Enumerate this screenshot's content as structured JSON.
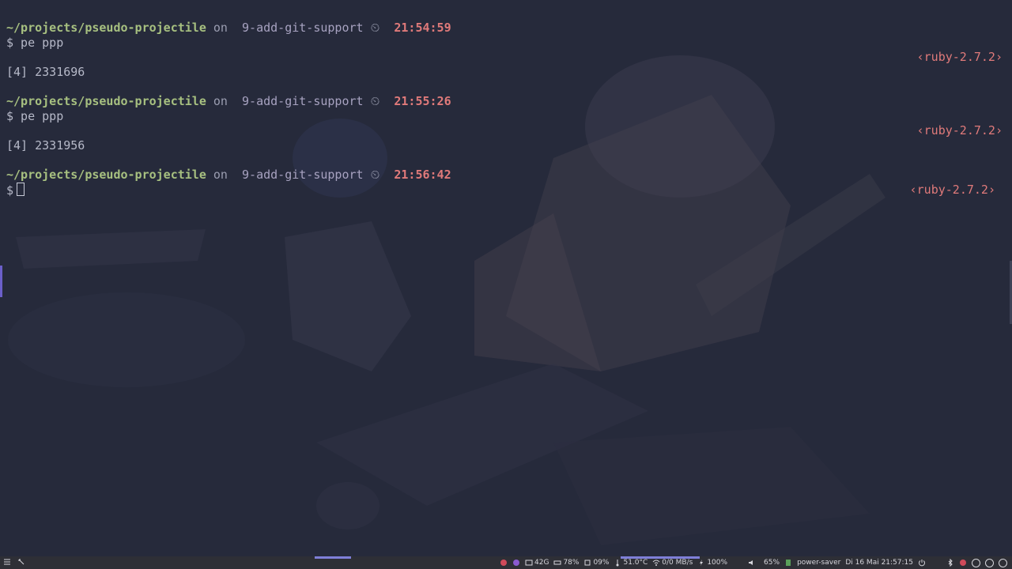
{
  "terminal": {
    "blocks": [
      {
        "path": "~/projects/pseudo-projectile",
        "on": "on",
        "branch_icon": "",
        "branch": "9-add-git-support",
        "clock_icon": "⏲",
        "time": "21:54:59",
        "command_line": "$ pe ppp",
        "ruby": "‹ruby-2.7.2›",
        "output": "[4] 2331696"
      },
      {
        "path": "~/projects/pseudo-projectile",
        "on": "on",
        "branch_icon": "",
        "branch": "9-add-git-support",
        "clock_icon": "⏲",
        "time": "21:55:26",
        "command_line": "$ pe ppp",
        "ruby": "‹ruby-2.7.2›",
        "output": "[4] 2331956"
      },
      {
        "path": "~/projects/pseudo-projectile",
        "on": "on",
        "branch_icon": "",
        "branch": "9-add-git-support",
        "clock_icon": "⏲",
        "time": "21:56:42",
        "command_line": "$",
        "ruby": "‹ruby-2.7.2›"
      }
    ]
  },
  "taskbar": {
    "disk": "42G",
    "memory": "78%",
    "cpu": "09%",
    "temperature": "51.0°C",
    "network": "0/0 MB/s",
    "battery": "100%",
    "volume": "65%",
    "power_profile": "power-saver",
    "datetime": "Di 16 Mai 21:57:15",
    "colors": {
      "accent": "#7f7fd8",
      "path": "#a7c080",
      "time": "#e07a7a"
    }
  }
}
